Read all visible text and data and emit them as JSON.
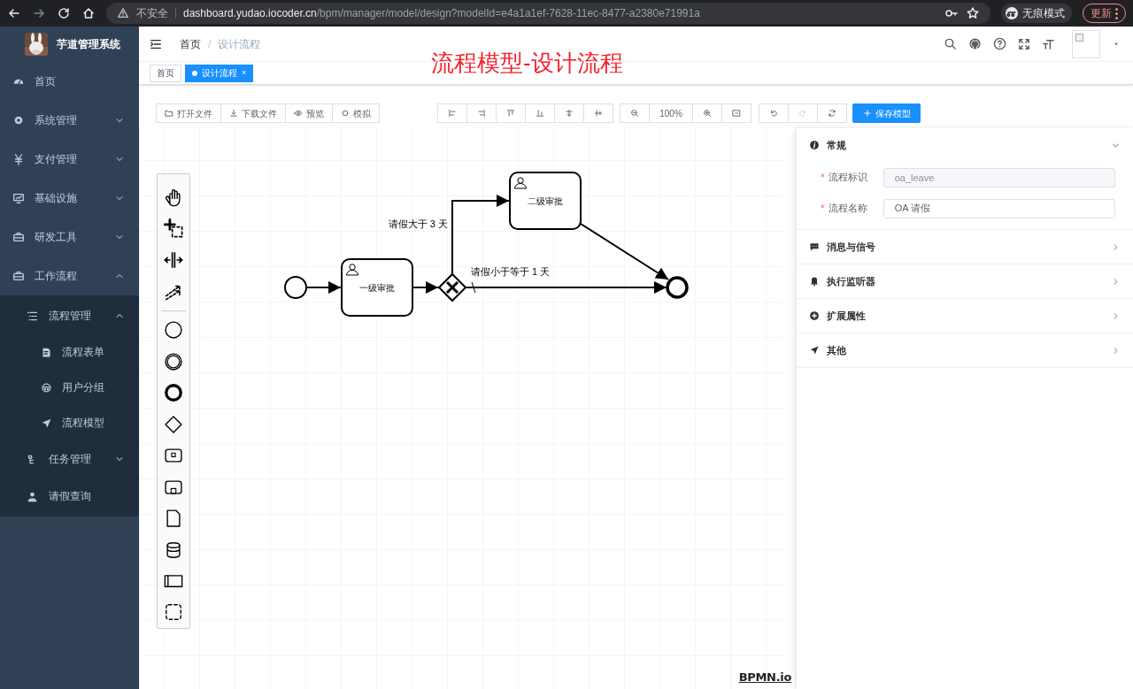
{
  "browser": {
    "security": "不安全",
    "url_host": "dashboard.yudao.iocoder.cn",
    "url_path": "/bpm/manager/model/design?modelId=e4a1a1ef-7628-11ec-8477-a2380e71991a",
    "profile": "无痕模式",
    "update": "更新"
  },
  "sidebar": {
    "title": "芋道管理系统",
    "items": [
      {
        "label": "首页"
      },
      {
        "label": "系统管理",
        "expanded": false
      },
      {
        "label": "支付管理",
        "expanded": false
      },
      {
        "label": "基础设施",
        "expanded": false
      },
      {
        "label": "研发工具",
        "expanded": false
      },
      {
        "label": "工作流程",
        "expanded": true,
        "children": [
          {
            "label": "流程管理",
            "expanded": true,
            "children": [
              {
                "label": "流程表单"
              },
              {
                "label": "用户分组"
              },
              {
                "label": "流程模型"
              }
            ]
          },
          {
            "label": "任务管理",
            "expanded": false
          },
          {
            "label": "请假查询"
          }
        ]
      }
    ]
  },
  "breadcrumb": [
    "首页",
    "设计流程"
  ],
  "breadcrumb_separator": "/",
  "tags": [
    {
      "label": "首页",
      "selected": false
    },
    {
      "label": "设计流程",
      "selected": true,
      "close": "×"
    }
  ],
  "overlay_title": "流程模型-设计流程",
  "toolbar": {
    "file_buttons": [
      "打开文件",
      "下载文件",
      "预览",
      "模拟"
    ],
    "zoom": "100%",
    "history_buttons": [
      {
        "disabled": false
      },
      {
        "disabled": true
      },
      {
        "disabled": false
      }
    ],
    "save": "保存模型"
  },
  "diagram": {
    "tasks": [
      {
        "label": "一级审批"
      },
      {
        "label": "二级审批"
      }
    ],
    "flows": [
      {
        "label": "请假大于 3 天"
      },
      {
        "label": "请假小于等于 1 天"
      }
    ],
    "watermark": "BPMN.io"
  },
  "panel": {
    "required_mark": "*",
    "sections": [
      {
        "title": "常规",
        "expanded": true,
        "fields": [
          {
            "label": "流程标识",
            "value": "oa_leave",
            "required": true,
            "disabled": true
          },
          {
            "label": "流程名称",
            "value": "OA 请假",
            "required": true,
            "disabled": false
          }
        ]
      },
      {
        "title": "消息与信号",
        "expanded": false
      },
      {
        "title": "执行监听器",
        "expanded": false
      },
      {
        "title": "扩展属性",
        "expanded": false
      },
      {
        "title": "其他",
        "expanded": false
      }
    ]
  }
}
